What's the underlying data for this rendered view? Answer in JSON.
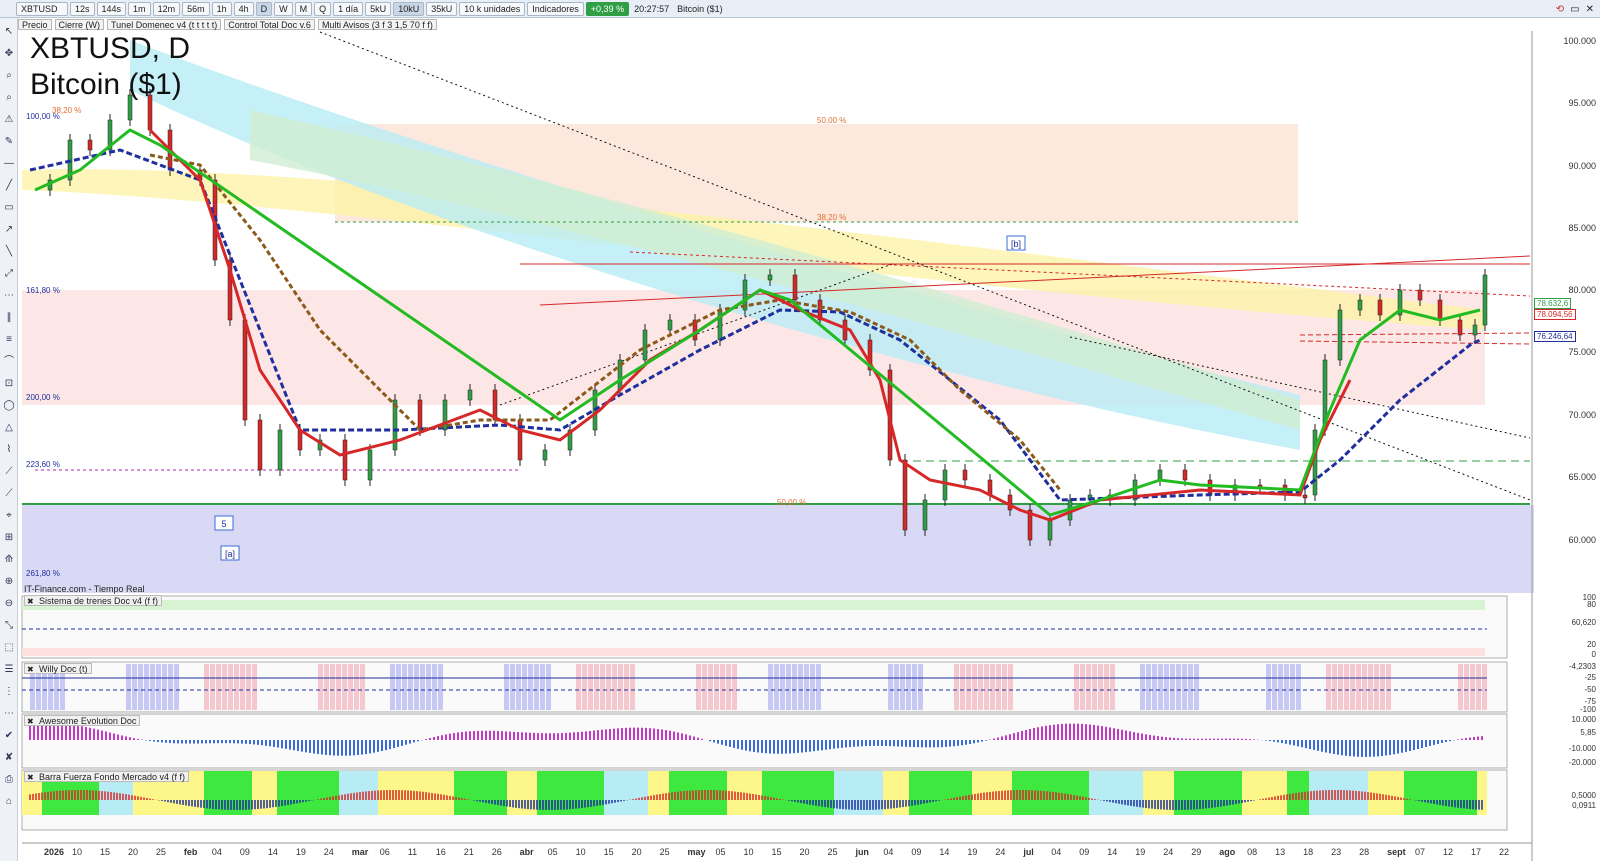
{
  "toolbar": {
    "symbol": "XBTUSD",
    "timeframes": [
      "12s",
      "144s",
      "1m",
      "12m",
      "56m",
      "1h",
      "4h",
      "D",
      "W",
      "M",
      "Q"
    ],
    "active_timeframe": "D",
    "period": "1 día",
    "units": [
      "5kU",
      "10kU",
      "35kU"
    ],
    "active_unit": "10kU",
    "unit_select": "10 k unidades",
    "indicators": "Indicadores",
    "change_badge": "+0,39 %",
    "time": "20:27:57",
    "instrument": "Bitcoin ($1)"
  },
  "toolbar2": {
    "items": [
      "Precio",
      "Cierre (W)",
      "Tunel Domenec v4 (t t t t t)",
      "Control Total Doc v.6",
      "Multi Avisos (3 f 3 1,5 70 f f)"
    ]
  },
  "chart": {
    "title": "XBTUSD, D",
    "subtitle": "Bitcoin ($1)",
    "source": "IT-Finance.com - Tiempo Real",
    "fib_labels": [
      "100,00 %",
      "161,80 %",
      "200,00 %",
      "223,60 %",
      "261,80 %",
      "50,00 %",
      "38,20 %",
      "50,00 %",
      "38,20 %"
    ],
    "wave_labels": [
      "[b]",
      "5",
      "[a]"
    ],
    "price_axis": [
      "100.000",
      "95.000",
      "90.000",
      "85.000",
      "80.000",
      "75.000",
      "70.000",
      "65.000",
      "60.000"
    ],
    "price_tags": [
      "78.632,6",
      "78.094,56",
      "76.246,64"
    ],
    "date_axis": [
      "2026",
      "10",
      "15",
      "20",
      "25",
      "feb",
      "04",
      "09",
      "14",
      "19",
      "24",
      "mar",
      "06",
      "11",
      "16",
      "21",
      "26",
      "abr",
      "05",
      "10",
      "15",
      "20",
      "25",
      "may",
      "05",
      "10",
      "15",
      "20",
      "25",
      "jun",
      "04",
      "09",
      "14",
      "19",
      "24",
      "jul",
      "04",
      "09",
      "14",
      "19",
      "24",
      "29",
      "ago",
      "08",
      "13",
      "18",
      "23",
      "28",
      "sept",
      "07",
      "12",
      "17",
      "22"
    ]
  },
  "panels": [
    {
      "name": "Sistema de trenes Doc v4 (f f)",
      "axis": [
        "100",
        "80",
        "60,620",
        "20",
        "0"
      ]
    },
    {
      "name": "Willy Doc (t)",
      "axis": [
        "-4,2303",
        "-25",
        "-50",
        "-75",
        "-100"
      ]
    },
    {
      "name": "Awesome Evolution Doc",
      "axis": [
        "10.000",
        "5,85",
        "-10.000",
        "-20.000"
      ]
    },
    {
      "name": "Barra Fuerza Fondo Mercado v4 (f f)",
      "axis": [
        "0,5000",
        "0,0911"
      ]
    }
  ],
  "colors": {
    "up": "#2f9e44",
    "down": "#d62828",
    "trend_blue": "#1f2f9e",
    "brown": "#8b5a1a",
    "support_green": "#2f9e44"
  }
}
